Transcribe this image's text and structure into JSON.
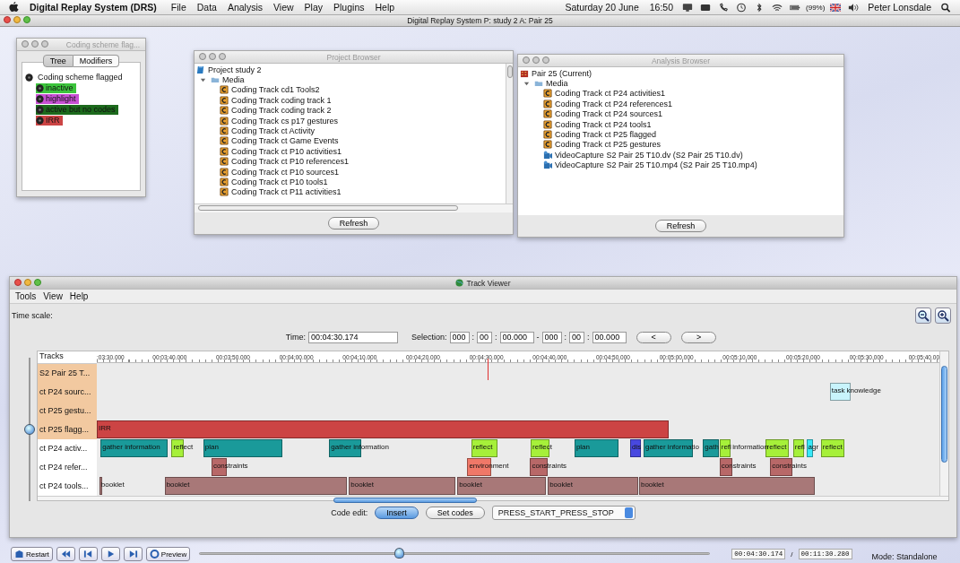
{
  "menubar": {
    "app": "Digital Replay System (DRS)",
    "menus": [
      "File",
      "Data",
      "Analysis",
      "View",
      "Play",
      "Plugins",
      "Help"
    ],
    "date": "Saturday 20 June",
    "time": "16:50",
    "battery": "(99%)",
    "user": "Peter Lonsdale"
  },
  "main_window": {
    "title": "Digital Replay System P: study 2 A: Pair 25"
  },
  "coding_scheme": {
    "title": "Coding scheme flag...",
    "tabs": [
      {
        "label": "Tree",
        "selected": true
      },
      {
        "label": "Modifiers",
        "selected": false
      }
    ],
    "root": "Coding scheme flagged",
    "codes": [
      {
        "label": "inactive",
        "color": "#3cc43c"
      },
      {
        "label": "highlight",
        "color": "#c850d4"
      },
      {
        "label": "active but no codes",
        "color": "#1c6a1c"
      },
      {
        "label": "IRR",
        "color": "#cc4444"
      }
    ]
  },
  "project_browser": {
    "title": "Project Browser",
    "root": "Project study 2",
    "folder": {
      "label": "Media",
      "expanded": true,
      "children": [
        {
          "label": "Coding Track cd1 Tools2",
          "kind": "coding"
        },
        {
          "label": "Coding Track coding track 1",
          "kind": "coding"
        },
        {
          "label": "Coding Track coding track 2",
          "kind": "coding"
        },
        {
          "label": "Coding Track cs p17 gestures",
          "kind": "coding"
        },
        {
          "label": "Coding Track ct Activity",
          "kind": "coding"
        },
        {
          "label": "Coding Track ct Game Events",
          "kind": "coding"
        },
        {
          "label": "Coding Track ct P10 activities1",
          "kind": "coding"
        },
        {
          "label": "Coding Track ct P10 references1",
          "kind": "coding"
        },
        {
          "label": "Coding Track ct P10 sources1",
          "kind": "coding"
        },
        {
          "label": "Coding Track ct P10 tools1",
          "kind": "coding"
        },
        {
          "label": "Coding Track ct P11 activities1",
          "kind": "coding"
        }
      ]
    },
    "button": "Refresh"
  },
  "analysis_browser": {
    "title": "Analysis Browser",
    "root": "Pair 25 (Current)",
    "folder": {
      "label": "Media",
      "expanded": true,
      "children": [
        {
          "label": "Coding Track ct P24 activities1",
          "kind": "coding"
        },
        {
          "label": "Coding Track ct P24 references1",
          "kind": "coding"
        },
        {
          "label": "Coding Track ct P24 sources1",
          "kind": "coding"
        },
        {
          "label": "Coding Track ct P24 tools1",
          "kind": "coding"
        },
        {
          "label": "Coding Track ct P25 flagged",
          "kind": "coding"
        },
        {
          "label": "Coding Track ct P25 gestures",
          "kind": "coding"
        },
        {
          "label": "VideoCapture S2 Pair 25 T10.dv (S2 Pair 25 T10.dv)",
          "kind": "video"
        },
        {
          "label": "VideoCapture S2 Pair 25 T10.mp4 (S2 Pair 25 T10.mp4)",
          "kind": "video"
        }
      ]
    },
    "button": "Refresh"
  },
  "track_viewer": {
    "title": "Track Viewer",
    "menus": [
      "Tools",
      "View",
      "Help"
    ],
    "time_scale_label": "Time scale:",
    "time_label": "Time:",
    "time": "00:04:30.174",
    "selection_label": "Selection:",
    "selection_start": [
      "000",
      "00",
      "00.000"
    ],
    "selection_end": [
      "000",
      "00",
      "00.000"
    ],
    "separator": ":",
    "dash": "-",
    "prev": "<",
    "next": ">",
    "tracks_heading": "Tracks",
    "ticks": [
      ":03:30.000",
      "00:03:40.000",
      "00:03:50.000",
      "00:04:00.000",
      "00:04:10.000",
      "00:04:20.000",
      "00:04:30.000",
      "00:04:40.000",
      "00:04:50.000",
      "00:05:00.000",
      "00:05:10.000",
      "00:05:20.000",
      "00:05:30.000",
      "00:05:40.00"
    ],
    "zoom_slider": {
      "level": 0.5
    },
    "tracks": [
      {
        "name": "S2 Pair 25 T...",
        "highlighted": true
      },
      {
        "name": "ct P24 sourc...",
        "highlighted": true,
        "segments": [
          {
            "kind": "bar",
            "label": "task knowledge",
            "color": "#c8f4fc"
          }
        ]
      },
      {
        "name": "ct P25 gestu...",
        "highlighted": true
      },
      {
        "name": "ct P25 flagg...",
        "highlighted": true,
        "segments": [
          {
            "kind": "bar",
            "label": "IRR",
            "color": "#cc4444"
          }
        ]
      },
      {
        "name": "ct P24 activ...",
        "highlighted": false,
        "segments": [
          {
            "kind": "bar",
            "label": "gather information",
            "color": "#1a9a9a"
          },
          {
            "kind": "bar",
            "label": "reflect",
            "color": "#a6f03a"
          },
          {
            "kind": "bar",
            "label": "plan",
            "color": "#1a9a9a"
          },
          {
            "kind": "bar",
            "label": "gather information",
            "color": "#1a9a9a"
          },
          {
            "kind": "bar",
            "label": "reflect",
            "color": "#a6f03a"
          },
          {
            "kind": "bar",
            "label": "reflect",
            "color": "#a6f03a"
          },
          {
            "kind": "bar",
            "label": "plan",
            "color": "#1a9a9a"
          },
          {
            "kind": "bar",
            "label": "dis",
            "color": "#4848e0"
          },
          {
            "kind": "bar",
            "label": "gather informatio",
            "color": "#1a9a9a"
          },
          {
            "kind": "bar",
            "label": "gath",
            "color": "#1a9a9a"
          },
          {
            "kind": "bar",
            "label": "refl",
            "color": "#a6f03a"
          },
          {
            "kind": "text",
            "label": "information"
          },
          {
            "kind": "bar",
            "label": "reflect",
            "color": "#a6f03a"
          },
          {
            "kind": "bar",
            "label": "refl",
            "color": "#a6f03a"
          },
          {
            "kind": "bar",
            "label": "agr",
            "color": "#38e8f8"
          },
          {
            "kind": "bar",
            "label": "reflect",
            "color": "#a6f03a"
          }
        ]
      },
      {
        "name": "ct P24 refer...",
        "highlighted": false,
        "segments": [
          {
            "kind": "bar",
            "label": "constraints",
            "color": "#b86868"
          },
          {
            "kind": "bar",
            "label": "environment",
            "color": "#f07868"
          },
          {
            "kind": "bar",
            "label": "constraints",
            "color": "#b86868"
          },
          {
            "kind": "bar",
            "label": "constraints",
            "color": "#b86868"
          },
          {
            "kind": "bar",
            "label": "constraints",
            "color": "#b86868"
          }
        ]
      },
      {
        "name": "ct P24 tools...",
        "highlighted": false,
        "segments": [
          {
            "kind": "bar",
            "label": "booklet",
            "color": "#a87878"
          },
          {
            "kind": "bar",
            "label": "booklet",
            "color": "#a87878"
          },
          {
            "kind": "bar",
            "label": "booklet",
            "color": "#a87878"
          },
          {
            "kind": "bar",
            "label": "booklet",
            "color": "#a87878"
          },
          {
            "kind": "bar",
            "label": "booklet",
            "color": "#a87878"
          },
          {
            "kind": "bar",
            "label": "booklet",
            "color": "#a87878"
          }
        ]
      }
    ],
    "code_edit_label": "Code edit:",
    "edit_buttons": [
      {
        "label": "Insert",
        "selected": true
      },
      {
        "label": "Set codes",
        "selected": false
      }
    ],
    "mode_select": "PRESS_START_PRESS_STOP"
  },
  "player": {
    "restart": "Restart",
    "preview": "Preview",
    "position": {
      "level": 0.39
    },
    "current": "00:04:30.174",
    "separator": "/",
    "total": "00:11:30.280",
    "mode": "Mode: Standalone"
  }
}
